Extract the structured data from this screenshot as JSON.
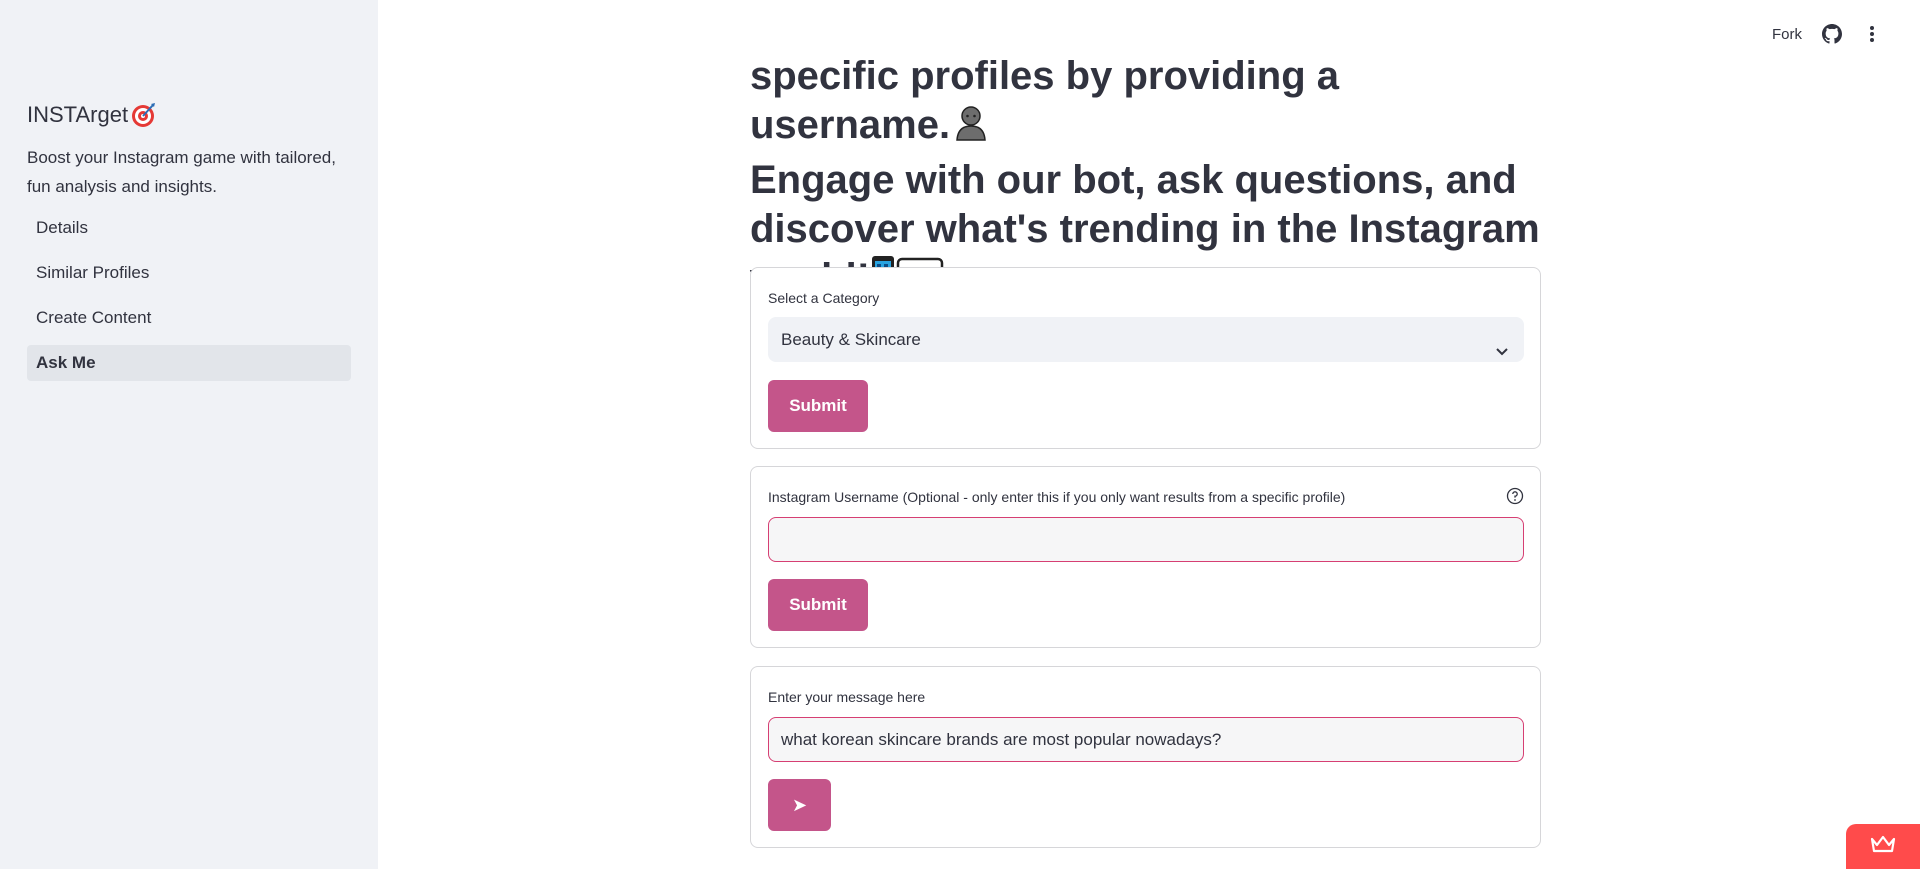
{
  "sidebar": {
    "brand": "INSTArget",
    "brand_icon": "target-icon",
    "tagline": "Boost your Instagram game with tailored, fun analysis and insights.",
    "items": [
      {
        "label": "Details",
        "active": false
      },
      {
        "label": "Similar Profiles",
        "active": false
      },
      {
        "label": "Create Content",
        "active": false
      },
      {
        "label": "Ask Me",
        "active": true
      }
    ]
  },
  "header": {
    "fork_label": "Fork",
    "github_icon": "github-icon",
    "menu_icon": "kebab-menu-icon"
  },
  "main": {
    "heading_line1": "specific profiles by providing a username.",
    "heading_line2": "Engage with our bot, ask questions, and",
    "heading_line3": "discover what's trending in the Instagram",
    "heading_line4": "world!",
    "category_form": {
      "label": "Select a Category",
      "selected": "Beauty & Skincare",
      "submit_label": "Submit"
    },
    "username_form": {
      "label": "Instagram Username (Optional - only enter this if you only want results from a specific profile)",
      "value": "",
      "submit_label": "Submit"
    },
    "message_form": {
      "label": "Enter your message here",
      "value": "what korean skincare brands are most popular nowadays?",
      "send_label": "➤"
    }
  },
  "colors": {
    "accent": "#c4558a",
    "input_border": "#d63f73",
    "sidebar_bg": "#f0f2f6",
    "badge": "#ff4b4b"
  }
}
